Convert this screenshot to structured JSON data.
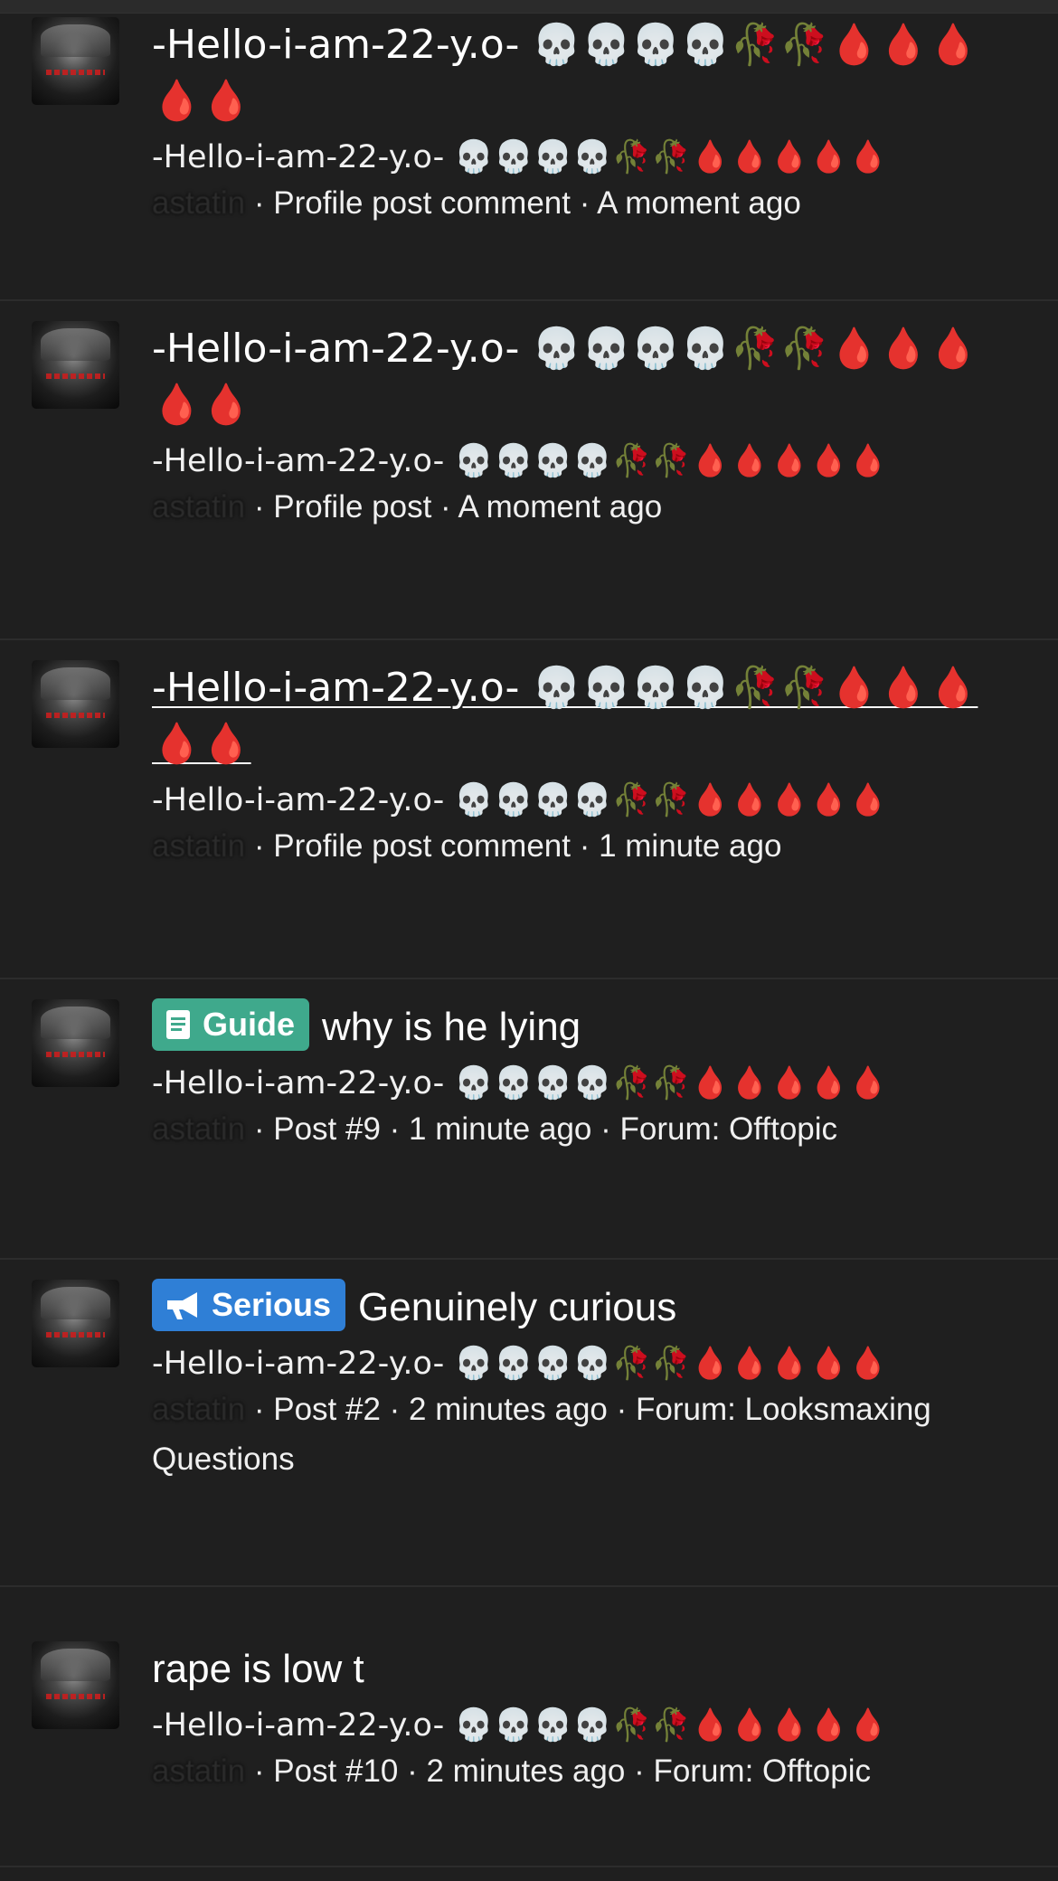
{
  "items": [
    {
      "title": "-Hello-i-am-22-y.o- 💀💀💀💀🥀🥀🩸🩸🩸🩸🩸",
      "author": "-Hello-i-am-22-y.o- 💀💀💀💀🥀🥀🩸🩸🩸🩸🩸",
      "context_user": "astatin",
      "meta": " · Profile post comment · A moment ago"
    },
    {
      "title": "-Hello-i-am-22-y.o- 💀💀💀💀🥀🥀🩸🩸🩸🩸🩸",
      "author": "-Hello-i-am-22-y.o- 💀💀💀💀🥀🥀🩸🩸🩸🩸🩸",
      "context_user": "astatin",
      "meta": " · Profile post · A moment ago"
    },
    {
      "title": "-Hello-i-am-22-y.o- 💀💀💀💀🥀🥀🩸🩸🩸🩸🩸",
      "author": "-Hello-i-am-22-y.o- 💀💀💀💀🥀🥀🩸🩸🩸🩸🩸",
      "context_user": "astatin",
      "meta": " · Profile post comment · 1 minute ago"
    },
    {
      "badge": {
        "label": "Guide",
        "icon": "book-icon",
        "color": "#3fa98c"
      },
      "title": "why is he lying",
      "author": "-Hello-i-am-22-y.o- 💀💀💀💀🥀🥀🩸🩸🩸🩸🩸",
      "context_user": "astatin",
      "meta": " · Post #9 · 1 minute ago · Forum: Offtopic"
    },
    {
      "badge": {
        "label": "Serious",
        "icon": "megaphone-icon",
        "color": "#2f7fd6"
      },
      "title": "Genuinely curious",
      "author": "-Hello-i-am-22-y.o- 💀💀💀💀🥀🥀🩸🩸🩸🩸🩸",
      "context_user": "astatin",
      "meta": " · Post #2 · 2 minutes ago · Forum: Looksmaxing Questions"
    },
    {
      "title": "rape is low t",
      "author": "-Hello-i-am-22-y.o- 💀💀💀💀🥀🥀🩸🩸🩸🩸🩸",
      "context_user": "astatin",
      "meta": " · Post #10 · 2 minutes ago · Forum: Offtopic"
    }
  ]
}
